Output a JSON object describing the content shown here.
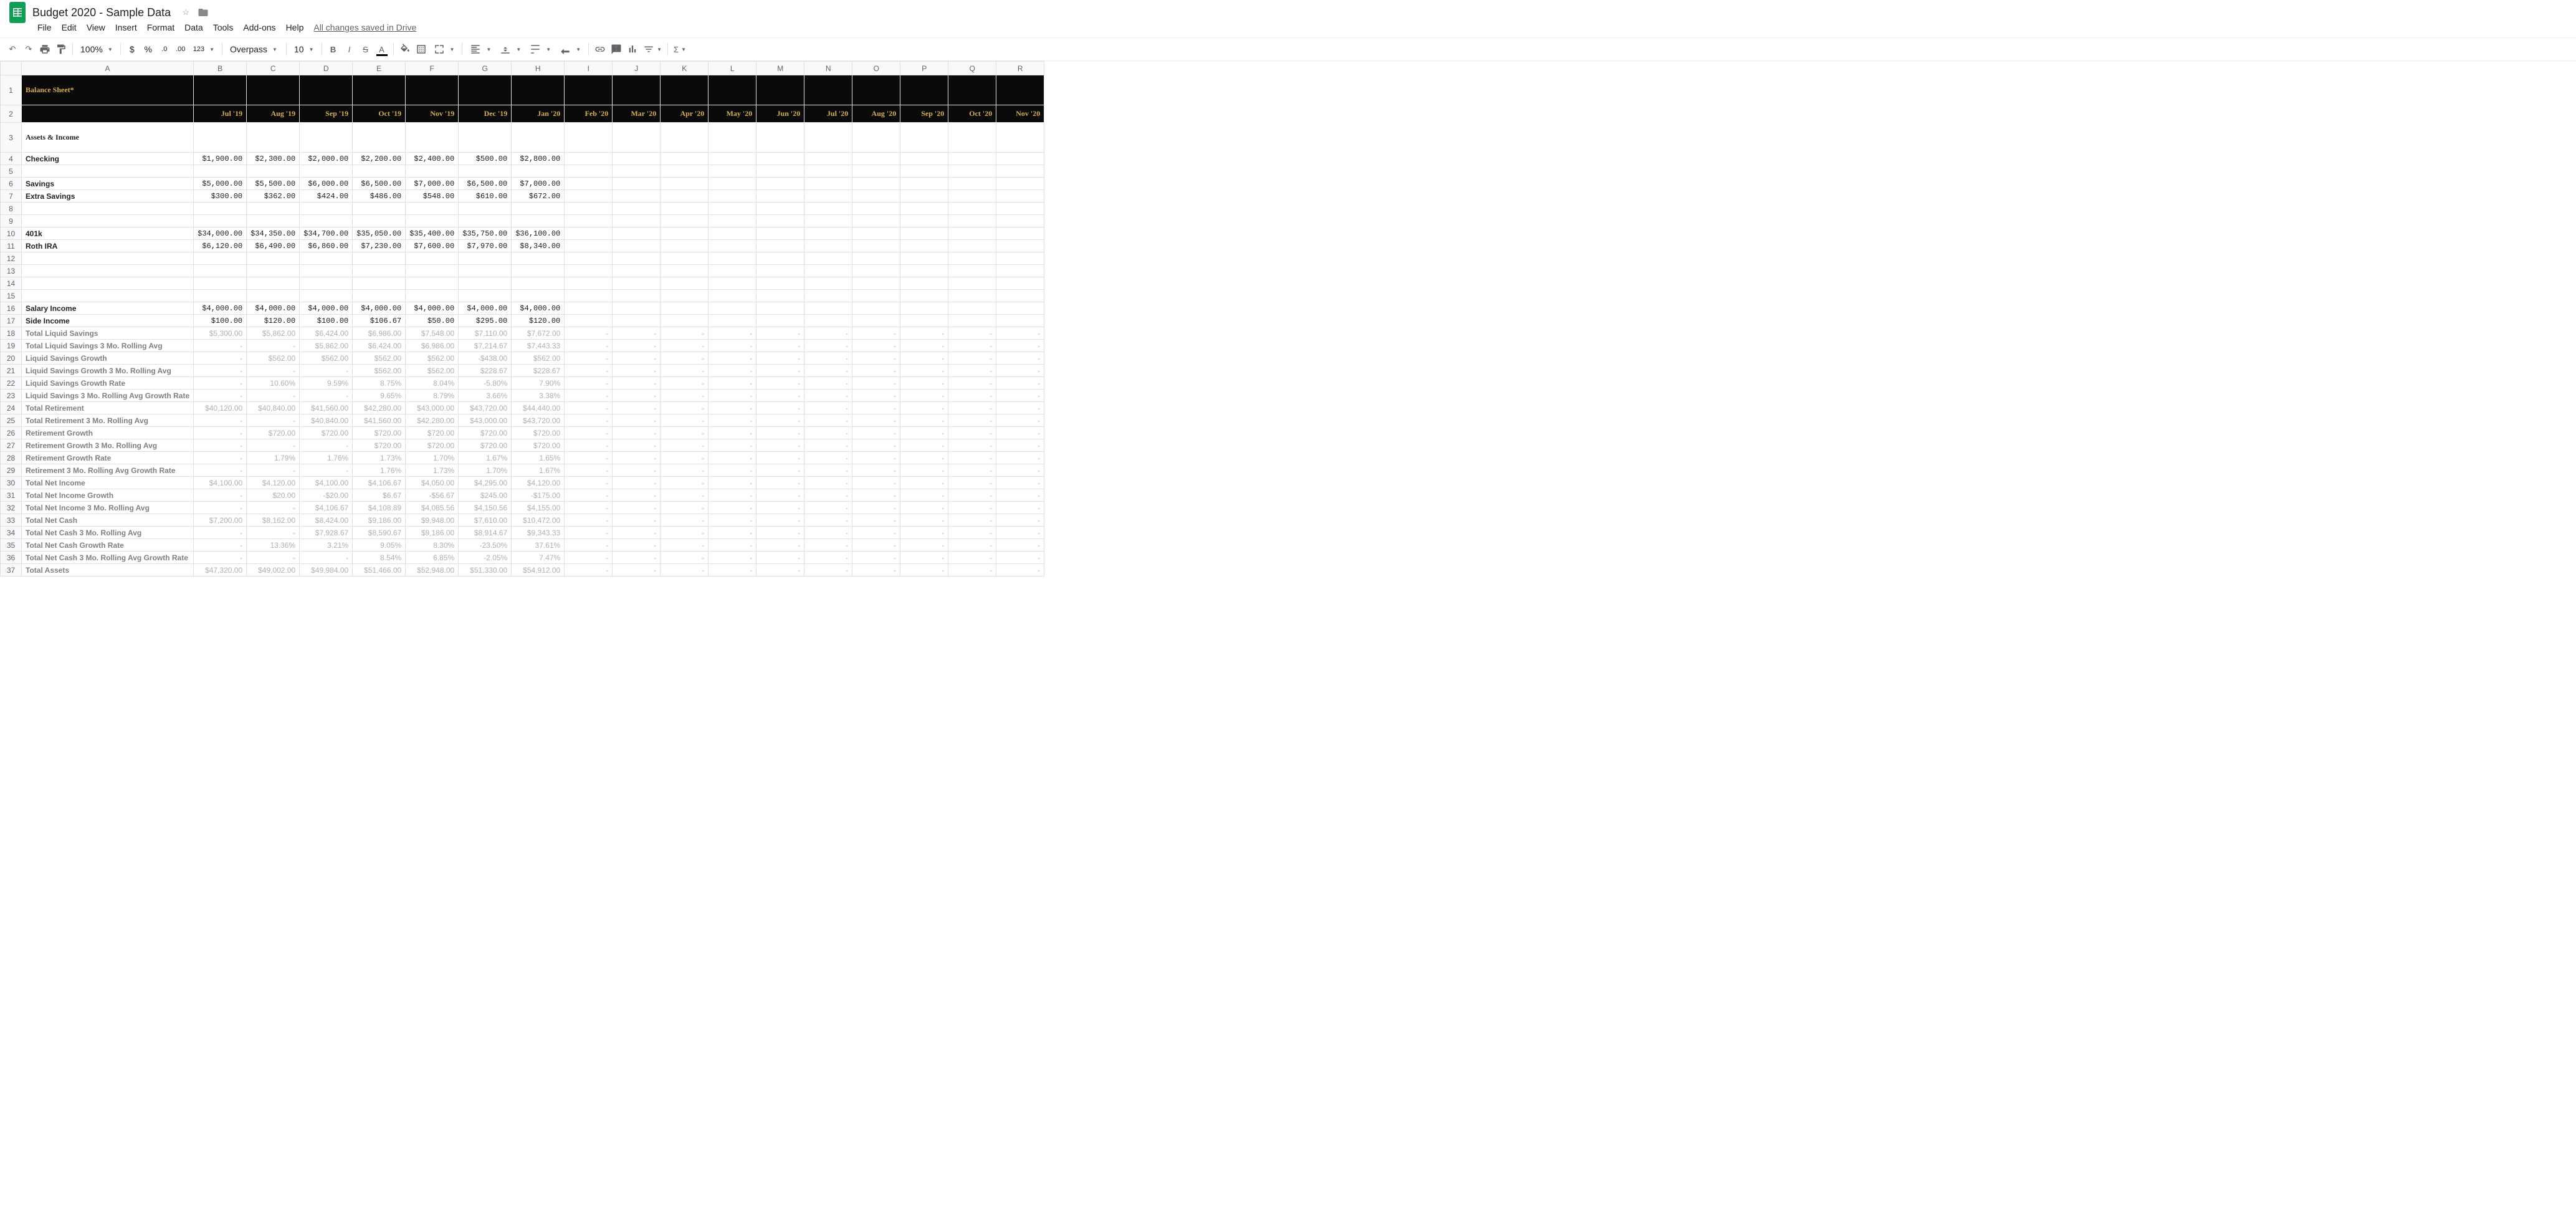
{
  "doc": {
    "title": "Budget 2020 - Sample Data"
  },
  "menu": {
    "file": "File",
    "edit": "Edit",
    "view": "View",
    "insert": "Insert",
    "format": "Format",
    "data": "Data",
    "tools": "Tools",
    "addons": "Add-ons",
    "help": "Help",
    "status": "All changes saved in Drive"
  },
  "toolbar": {
    "zoom": "100%",
    "currency": "$",
    "percent": "%",
    "decdec": ".0",
    "incdec": ".00",
    "numfmt": "123",
    "font": "Overpass",
    "fontsize": "10"
  },
  "columns": [
    "A",
    "B",
    "C",
    "D",
    "E",
    "F",
    "G",
    "H",
    "I",
    "J",
    "K",
    "L",
    "M",
    "N",
    "O",
    "P",
    "Q",
    "R"
  ],
  "months": [
    "Jul '19",
    "Aug '19",
    "Sep '19",
    "Oct '19",
    "Nov '19",
    "Dec '19",
    "Jan '20",
    "Feb '20",
    "Mar '20",
    "Apr '20",
    "May '20",
    "Jun '20",
    "Jul '20",
    "Aug '20",
    "Sep '20",
    "Oct '20",
    "Nov '20"
  ],
  "sheet": {
    "title": "Balance Sheet*",
    "section": "Assets & Income",
    "rows": {
      "checking": {
        "label": "Checking",
        "vals": [
          "$1,900.00",
          "$2,300.00",
          "$2,000.00",
          "$2,200.00",
          "$2,400.00",
          "$500.00",
          "$2,800.00"
        ]
      },
      "savings": {
        "label": "Savings",
        "vals": [
          "$5,000.00",
          "$5,500.00",
          "$6,000.00",
          "$6,500.00",
          "$7,000.00",
          "$6,500.00",
          "$7,000.00"
        ]
      },
      "extra_savings": {
        "label": "Extra Savings",
        "vals": [
          "$300.00",
          "$362.00",
          "$424.00",
          "$486.00",
          "$548.00",
          "$610.00",
          "$672.00"
        ]
      },
      "k401": {
        "label": "401k",
        "vals": [
          "$34,000.00",
          "$34,350.00",
          "$34,700.00",
          "$35,050.00",
          "$35,400.00",
          "$35,750.00",
          "$36,100.00"
        ]
      },
      "roth": {
        "label": "Roth IRA",
        "vals": [
          "$6,120.00",
          "$6,490.00",
          "$6,860.00",
          "$7,230.00",
          "$7,600.00",
          "$7,970.00",
          "$8,340.00"
        ]
      },
      "salary": {
        "label": "Salary Income",
        "vals": [
          "$4,000.00",
          "$4,000.00",
          "$4,000.00",
          "$4,000.00",
          "$4,000.00",
          "$4,000.00",
          "$4,000.00"
        ]
      },
      "side": {
        "label": "Side Income",
        "vals": [
          "$100.00",
          "$120.00",
          "$100.00",
          "$106.67",
          "$50.00",
          "$295.00",
          "$120.00"
        ]
      },
      "tls": {
        "label": "Total Liquid Savings",
        "vals": [
          "$5,300.00",
          "$5,862.00",
          "$6,424.00",
          "$6,986.00",
          "$7,548.00",
          "$7,110.00",
          "$7,672.00",
          "-",
          "-",
          "-",
          "-",
          "-",
          "-",
          "-",
          "-",
          "-",
          "-"
        ]
      },
      "tls3": {
        "label": "Total Liquid Savings 3 Mo. Rolling Avg",
        "vals": [
          "-",
          "-",
          "$5,862.00",
          "$6,424.00",
          "$6,986.00",
          "$7,214.67",
          "$7,443.33",
          "-",
          "-",
          "-",
          "-",
          "-",
          "-",
          "-",
          "-",
          "-",
          "-"
        ]
      },
      "lsg": {
        "label": "Liquid Savings Growth",
        "vals": [
          "-",
          "$562.00",
          "$562.00",
          "$562.00",
          "$562.00",
          "-$438.00",
          "$562.00",
          "-",
          "-",
          "-",
          "-",
          "-",
          "-",
          "-",
          "-",
          "-",
          "-"
        ]
      },
      "lsg3": {
        "label": "Liquid Savings Growth 3 Mo. Rolling Avg",
        "vals": [
          "-",
          "-",
          "-",
          "$562.00",
          "$562.00",
          "$228.67",
          "$228.67",
          "-",
          "-",
          "-",
          "-",
          "-",
          "-",
          "-",
          "-",
          "-",
          "-"
        ]
      },
      "lsgr": {
        "label": "Liquid Savings Growth Rate",
        "vals": [
          "-",
          "10.60%",
          "9.59%",
          "8.75%",
          "8.04%",
          "-5.80%",
          "7.90%",
          "-",
          "-",
          "-",
          "-",
          "-",
          "-",
          "-",
          "-",
          "-",
          "-"
        ]
      },
      "ls3gr": {
        "label": "Liquid Savings 3 Mo. Rolling Avg Growth Rate",
        "vals": [
          "-",
          "-",
          "-",
          "9.65%",
          "8.79%",
          "3.66%",
          "3.38%",
          "-",
          "-",
          "-",
          "-",
          "-",
          "-",
          "-",
          "-",
          "-",
          "-"
        ]
      },
      "tret": {
        "label": "Total Retirement",
        "vals": [
          "$40,120.00",
          "$40,840.00",
          "$41,560.00",
          "$42,280.00",
          "$43,000.00",
          "$43,720.00",
          "$44,440.00",
          "-",
          "-",
          "-",
          "-",
          "-",
          "-",
          "-",
          "-",
          "-",
          "-"
        ]
      },
      "tret3": {
        "label": "Total Retirement 3 Mo. Rolling Avg",
        "vals": [
          "-",
          "-",
          "$40,840.00",
          "$41,560.00",
          "$42,280.00",
          "$43,000.00",
          "$43,720.00",
          "-",
          "-",
          "-",
          "-",
          "-",
          "-",
          "-",
          "-",
          "-",
          "-"
        ]
      },
      "retg": {
        "label": "Retirement Growth",
        "vals": [
          "-",
          "$720.00",
          "$720.00",
          "$720.00",
          "$720.00",
          "$720.00",
          "$720.00",
          "-",
          "-",
          "-",
          "-",
          "-",
          "-",
          "-",
          "-",
          "-",
          "-"
        ]
      },
      "retg3": {
        "label": "Retirement Growth 3 Mo. Rolling Avg",
        "vals": [
          "-",
          "-",
          "-",
          "$720.00",
          "$720.00",
          "$720.00",
          "$720.00",
          "-",
          "-",
          "-",
          "-",
          "-",
          "-",
          "-",
          "-",
          "-",
          "-"
        ]
      },
      "retgr": {
        "label": "Retirement Growth Rate",
        "vals": [
          "-",
          "1.79%",
          "1.76%",
          "1.73%",
          "1.70%",
          "1.67%",
          "1.65%",
          "-",
          "-",
          "-",
          "-",
          "-",
          "-",
          "-",
          "-",
          "-",
          "-"
        ]
      },
      "ret3gr": {
        "label": "Retirement 3 Mo. Rolling Avg Growth Rate",
        "vals": [
          "-",
          "-",
          "-",
          "1.76%",
          "1.73%",
          "1.70%",
          "1.67%",
          "-",
          "-",
          "-",
          "-",
          "-",
          "-",
          "-",
          "-",
          "-",
          "-"
        ]
      },
      "tni": {
        "label": "Total Net Income",
        "vals": [
          "$4,100.00",
          "$4,120.00",
          "$4,100.00",
          "$4,106.67",
          "$4,050.00",
          "$4,295.00",
          "$4,120.00",
          "-",
          "-",
          "-",
          "-",
          "-",
          "-",
          "-",
          "-",
          "-",
          "-"
        ]
      },
      "tnig": {
        "label": "Total Net Income Growth",
        "vals": [
          "-",
          "$20.00",
          "-$20.00",
          "$6.67",
          "-$56.67",
          "$245.00",
          "-$175.00",
          "-",
          "-",
          "-",
          "-",
          "-",
          "-",
          "-",
          "-",
          "-",
          "-"
        ]
      },
      "tni3": {
        "label": "Total Net Income 3 Mo. Rolling Avg",
        "vals": [
          "-",
          "-",
          "$4,106.67",
          "$4,108.89",
          "$4,085.56",
          "$4,150.56",
          "$4,155.00",
          "-",
          "-",
          "-",
          "-",
          "-",
          "-",
          "-",
          "-",
          "-",
          "-"
        ]
      },
      "tnc": {
        "label": "Total Net Cash",
        "vals": [
          "$7,200.00",
          "$8,162.00",
          "$8,424.00",
          "$9,186.00",
          "$9,948.00",
          "$7,610.00",
          "$10,472.00",
          "-",
          "-",
          "-",
          "-",
          "-",
          "-",
          "-",
          "-",
          "-",
          "-"
        ]
      },
      "tnc3": {
        "label": "Total Net Cash 3 Mo. Rolling Avg",
        "vals": [
          "-",
          "-",
          "$7,928.67",
          "$8,590.67",
          "$9,186.00",
          "$8,914.67",
          "$9,343.33",
          "-",
          "-",
          "-",
          "-",
          "-",
          "-",
          "-",
          "-",
          "-",
          "-"
        ]
      },
      "tncgr": {
        "label": "Total Net Cash Growth Rate",
        "vals": [
          "-",
          "13.36%",
          "3.21%",
          "9.05%",
          "8.30%",
          "-23.50%",
          "37.61%",
          "-",
          "-",
          "-",
          "-",
          "-",
          "-",
          "-",
          "-",
          "-",
          "-"
        ]
      },
      "tnc3gr": {
        "label": "Total Net Cash 3 Mo. Rolling Avg Growth Rate",
        "vals": [
          "-",
          "-",
          "-",
          "8.54%",
          "6.85%",
          "-2.05%",
          "7.47%",
          "-",
          "-",
          "-",
          "-",
          "-",
          "-",
          "-",
          "-",
          "-",
          "-"
        ]
      },
      "tassets": {
        "label": "Total Assets",
        "vals": [
          "$47,320.00",
          "$49,002.00",
          "$49,984.00",
          "$51,466.00",
          "$52,948.00",
          "$51,330.00",
          "$54,912.00",
          "-",
          "-",
          "-",
          "-",
          "-",
          "-",
          "-",
          "-",
          "-",
          "-"
        ]
      }
    }
  }
}
